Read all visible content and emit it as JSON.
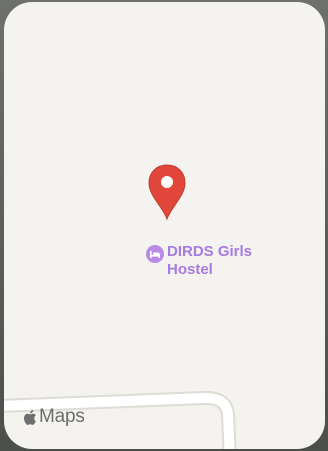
{
  "poi": {
    "name": "DIRDS Girls Hostel",
    "category_icon": "bed-icon",
    "color": "#a77be0"
  },
  "pin": {
    "icon": "map-pin-icon",
    "color": "#e0463a"
  },
  "attribution": {
    "logo": "apple-logo-icon",
    "text": "Maps"
  },
  "map": {
    "background": "#f4f3ef",
    "road_color": "#ffffff"
  }
}
